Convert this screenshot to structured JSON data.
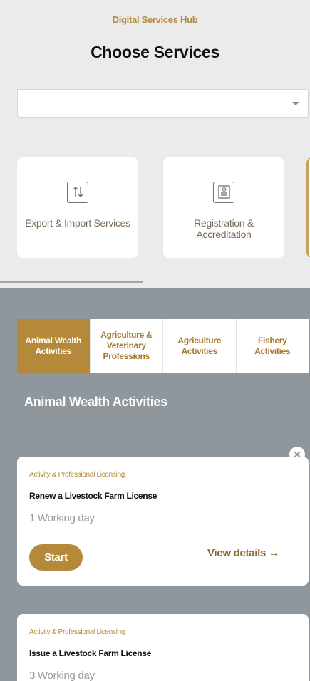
{
  "header": {
    "hub_label": "Digital Services Hub",
    "title": "Choose Services"
  },
  "service_select": {
    "value": ""
  },
  "categories": [
    {
      "label": "Export & Import Services",
      "icon": "export-import-icon"
    },
    {
      "label": "Registration & Accreditation",
      "icon": "certificate-icon"
    }
  ],
  "tabs": [
    {
      "label": "Animal Wealth Activities",
      "active": true
    },
    {
      "label": "Agriculture & Veterinary Professions",
      "active": false
    },
    {
      "label": "Agriculture Activities",
      "active": false
    },
    {
      "label": "Fishery Activities",
      "active": false
    }
  ],
  "section": {
    "title": "Animal Wealth Activities",
    "close_symbol": "✕"
  },
  "services": [
    {
      "category": "Activity & Professional Licensing",
      "name": "Renew a Livestock Farm License",
      "duration": "1 Working day",
      "start_label": "Start",
      "details_label": "View details →"
    },
    {
      "category": "Activity & Professional Licensing",
      "name": "Issue a Livestock Farm License",
      "duration": "3 Working day"
    }
  ],
  "colors": {
    "accent": "#b48a3a",
    "panel_bg": "#8f979d",
    "page_bg": "#ebebeb"
  }
}
